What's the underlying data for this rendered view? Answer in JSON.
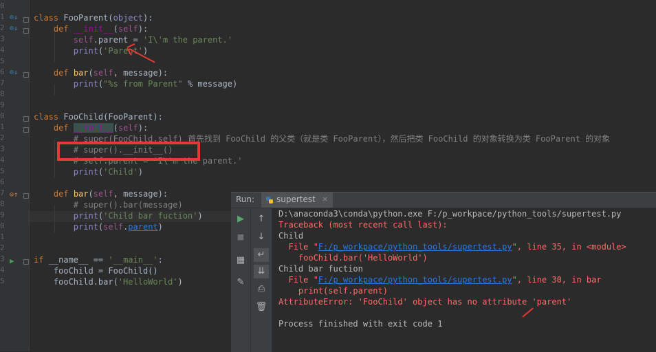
{
  "gutter": {
    "line_numbers": [
      "0",
      "1",
      "2",
      "3",
      "4",
      "5",
      "6",
      "7",
      "8",
      "9",
      "0",
      "1",
      "2",
      "3",
      "4",
      "5",
      "6",
      "7",
      "8",
      "9",
      "0",
      "1",
      "2",
      "3",
      "4",
      "5"
    ]
  },
  "code": {
    "l0_kw": "class ",
    "l0_name": "FooParent",
    "l0_p": "(",
    "l0_base": "object",
    "l0_e": "):",
    "l1_kw": "def ",
    "l1_name": "__init__",
    "l1_p": "(",
    "l1_self": "self",
    "l1_e": "):",
    "l2_self": "self",
    "l2_a": ".parent = ",
    "l2_s": "'I\\'m the parent.'",
    "l3_b": "print",
    "l3_p": "(",
    "l3_s": "'Parent'",
    "l3_e": ")",
    "l5_kw": "def ",
    "l5_name": "bar",
    "l5_p": "(",
    "l5_self": "self",
    "l5_e": ", message):",
    "l6_b": "print",
    "l6_p": "(",
    "l6_s": "\"%s from Parent\"",
    "l6_e": " % message)",
    "l9_kw": "class ",
    "l9_name": "FooChild",
    "l9_e": "(FooParent):",
    "l10_kw": "def ",
    "l10_name": "__init__",
    "l10_p": "(",
    "l10_self": "self",
    "l10_e": "):",
    "l11_cm": "# super(FooChild,self) 首先找到 FooChild 的父类（就是类 FooParent），然后把类 FooChild 的对象转换为类 FooParent 的对象",
    "l12_cm": "# super().__init__()",
    "l13_cm": "# self.parent = 'I\\'m the parent.'",
    "l14_b": "print",
    "l14_p": "(",
    "l14_s": "'Child'",
    "l14_e": ")",
    "l16_kw": "def ",
    "l16_name": "bar",
    "l16_p": "(",
    "l16_self": "self",
    "l16_e": ", message):",
    "l17_cm": "# super().bar(message)",
    "l18_b": "print",
    "l18_p": "(",
    "l18_s": "'Child bar fuction'",
    "l18_e": ")",
    "l19_b": "print",
    "l19_p": "(",
    "l19_self": "self",
    "l19_dot": ".",
    "l19_attr": "parent",
    "l19_e": ")",
    "l22_kw": "if ",
    "l22_a": "__name__ == ",
    "l22_s": "'__main__'",
    "l22_e": ":",
    "l23_a": "fooChild = FooChild()",
    "l24_a": "fooChild.bar(",
    "l24_s": "'HelloWorld'",
    "l24_e": ")"
  },
  "run": {
    "label": "Run:",
    "tab_name": "supertest",
    "tab_close": "×"
  },
  "output": {
    "o0": "D:\\anaconda3\\conda\\python.exe F:/p_workpace/python_tools/supertest.py",
    "o1": "Traceback (most recent call last):",
    "o2": "Child",
    "o3_a": "  File \"",
    "o3_link": "F:/p_workpace/python_tools/supertest.py",
    "o3_b": "\", line 35, in <module>",
    "o4": "    fooChild.bar('HelloWorld')",
    "o5": "Child bar fuction",
    "o6_a": "  File \"",
    "o6_link": "F:/p_workpace/python_tools/supertest.py",
    "o6_b": "\", line 30, in bar",
    "o7": "    print(self.parent)",
    "o8": "AttributeError: 'FooChild' object has no attribute 'parent'",
    "o10": "Process finished with exit code 1"
  },
  "colors": {
    "keyword": "#cc7832",
    "function": "#ffc66d",
    "string": "#6a8759",
    "comment": "#808080",
    "error": "#ff6b68",
    "annotation_red": "#e53935"
  }
}
